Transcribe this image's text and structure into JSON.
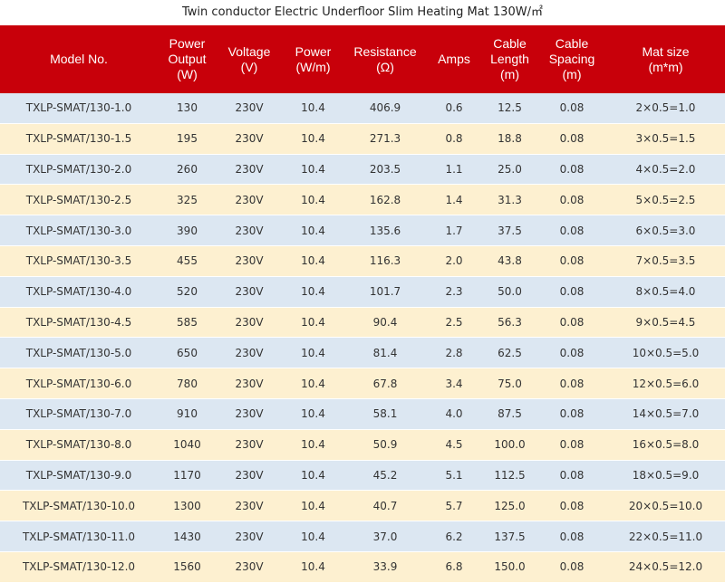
{
  "title": "Twin conductor Electric Underfloor Slim Heating Mat 130W/㎡",
  "colors": {
    "header_bg": "#c8000a",
    "row_odd": "#dce7f2",
    "row_even": "#fdf0d0"
  },
  "headers": [
    "Model No.",
    "Power\nOutput\n(W)",
    "Voltage\n(V)",
    "Power\n(W/m)",
    "Resistance\n(Ω)",
    "Amps",
    "Cable\nLength\n(m)",
    "Cable\nSpacing\n(m)",
    "Mat size\n(m*m)"
  ],
  "rows": [
    [
      "TXLP-SMAT/130-1.0",
      "130",
      "230V",
      "10.4",
      "406.9",
      "0.6",
      "12.5",
      "0.08",
      "2×0.5=1.0"
    ],
    [
      "TXLP-SMAT/130-1.5",
      "195",
      "230V",
      "10.4",
      "271.3",
      "0.8",
      "18.8",
      "0.08",
      "3×0.5=1.5"
    ],
    [
      "TXLP-SMAT/130-2.0",
      "260",
      "230V",
      "10.4",
      "203.5",
      "1.1",
      "25.0",
      "0.08",
      "4×0.5=2.0"
    ],
    [
      "TXLP-SMAT/130-2.5",
      "325",
      "230V",
      "10.4",
      "162.8",
      "1.4",
      "31.3",
      "0.08",
      "5×0.5=2.5"
    ],
    [
      "TXLP-SMAT/130-3.0",
      "390",
      "230V",
      "10.4",
      "135.6",
      "1.7",
      "37.5",
      "0.08",
      "6×0.5=3.0"
    ],
    [
      "TXLP-SMAT/130-3.5",
      "455",
      "230V",
      "10.4",
      "116.3",
      "2.0",
      "43.8",
      "0.08",
      "7×0.5=3.5"
    ],
    [
      "TXLP-SMAT/130-4.0",
      "520",
      "230V",
      "10.4",
      "101.7",
      "2.3",
      "50.0",
      "0.08",
      "8×0.5=4.0"
    ],
    [
      "TXLP-SMAT/130-4.5",
      "585",
      "230V",
      "10.4",
      "90.4",
      "2.5",
      "56.3",
      "0.08",
      "9×0.5=4.5"
    ],
    [
      "TXLP-SMAT/130-5.0",
      "650",
      "230V",
      "10.4",
      "81.4",
      "2.8",
      "62.5",
      "0.08",
      "10×0.5=5.0"
    ],
    [
      "TXLP-SMAT/130-6.0",
      "780",
      "230V",
      "10.4",
      "67.8",
      "3.4",
      "75.0",
      "0.08",
      "12×0.5=6.0"
    ],
    [
      "TXLP-SMAT/130-7.0",
      "910",
      "230V",
      "10.4",
      "58.1",
      "4.0",
      "87.5",
      "0.08",
      "14×0.5=7.0"
    ],
    [
      "TXLP-SMAT/130-8.0",
      "1040",
      "230V",
      "10.4",
      "50.9",
      "4.5",
      "100.0",
      "0.08",
      "16×0.5=8.0"
    ],
    [
      "TXLP-SMAT/130-9.0",
      "1170",
      "230V",
      "10.4",
      "45.2",
      "5.1",
      "112.5",
      "0.08",
      "18×0.5=9.0"
    ],
    [
      "TXLP-SMAT/130-10.0",
      "1300",
      "230V",
      "10.4",
      "40.7",
      "5.7",
      "125.0",
      "0.08",
      "20×0.5=10.0"
    ],
    [
      "TXLP-SMAT/130-11.0",
      "1430",
      "230V",
      "10.4",
      "37.0",
      "6.2",
      "137.5",
      "0.08",
      "22×0.5=11.0"
    ],
    [
      "TXLP-SMAT/130-12.0",
      "1560",
      "230V",
      "10.4",
      "33.9",
      "6.8",
      "150.0",
      "0.08",
      "24×0.5=12.0"
    ]
  ]
}
